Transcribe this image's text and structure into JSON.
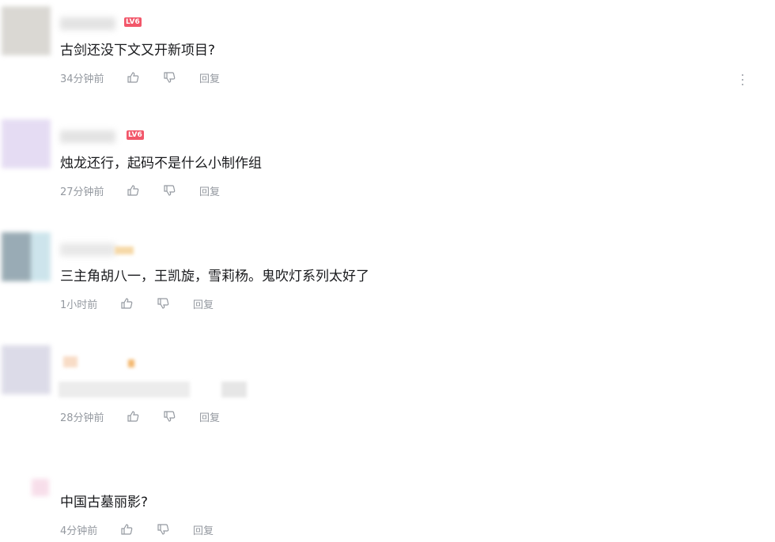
{
  "comments": [
    {
      "level": "LV6",
      "text": "古剑还没下文又开新项目?",
      "time": "34分钟前",
      "reply": "回复",
      "avatar_color": "#d6d4cf"
    },
    {
      "level": "LV6",
      "text": "烛龙还行，起码不是什么小制作组",
      "time": "27分钟前",
      "reply": "回复",
      "avatar_color": "#e3d9f2"
    },
    {
      "level": "",
      "text": "三主角胡八一，王凯旋，雪莉杨。鬼吹灯系列太好了",
      "time": "1小时前",
      "reply": "回复",
      "avatar_color": "#bcd6de"
    },
    {
      "level": "",
      "text": "",
      "time": "28分钟前",
      "reply": "回复",
      "avatar_color": "#d9d8e6"
    },
    {
      "level": "",
      "text": "中国古墓丽影?",
      "time": "4分钟前",
      "reply": "回复",
      "avatar_color": "#f7dbe8"
    }
  ],
  "colors": {
    "level_badge": "#f2576a",
    "meta_text": "#9499a0",
    "body_text": "#18191c"
  },
  "icons": {
    "like": "thumbs-up-icon",
    "dislike": "thumbs-down-icon",
    "more": "more-vertical-icon"
  }
}
